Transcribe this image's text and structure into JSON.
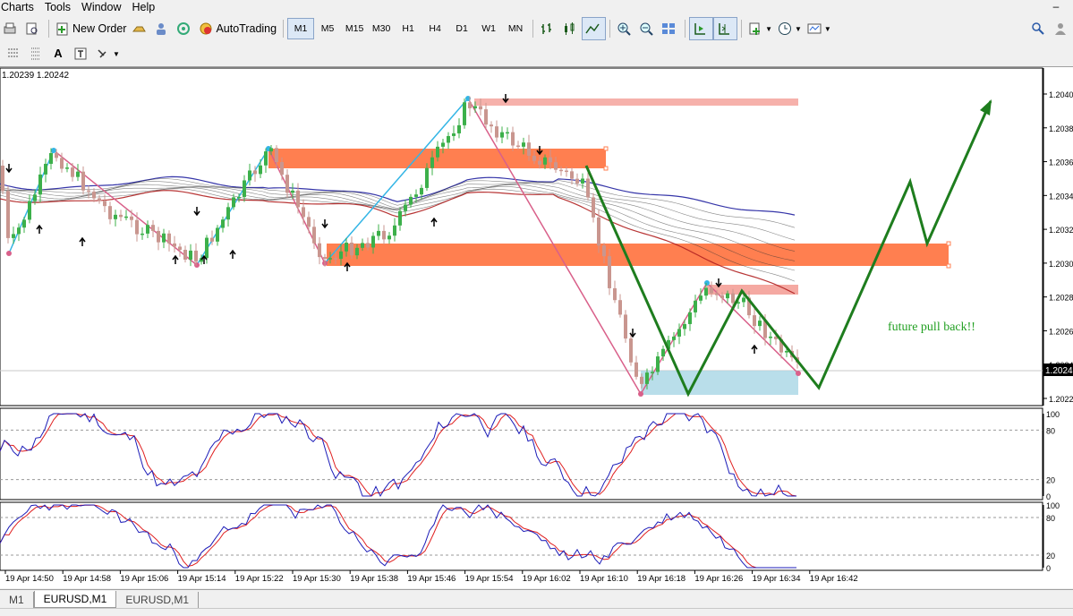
{
  "menu": {
    "items": [
      "Charts",
      "Tools",
      "Window",
      "Help"
    ]
  },
  "toolbar": {
    "new_order": "New Order",
    "autotrading": "AutoTrading",
    "timeframes": [
      "M1",
      "M5",
      "M15",
      "M30",
      "H1",
      "H4",
      "D1",
      "W1",
      "MN"
    ],
    "active_timeframe": "M1"
  },
  "chart": {
    "ohlc_label": "1.20239 1.20242",
    "current_price": "1.2024",
    "price_labels": [
      "1.2040",
      "1.2038",
      "1.2036",
      "1.2034",
      "1.2032",
      "1.2030",
      "1.2028",
      "1.2026",
      "1.2024",
      "1.2022"
    ],
    "time_labels": [
      "19 Apr 14:50",
      "19 Apr 14:58",
      "19 Apr 15:06",
      "19 Apr 15:14",
      "19 Apr 15:22",
      "19 Apr 15:30",
      "19 Apr 15:38",
      "19 Apr 15:46",
      "19 Apr 15:54",
      "19 Apr 16:02",
      "19 Apr 16:10",
      "19 Apr 16:18",
      "19 Apr 16:26",
      "19 Apr 16:34",
      "19 Apr 16:42"
    ],
    "annotation": "future pull back!!",
    "osc1_levels": [
      "100",
      "80",
      "20",
      "0"
    ],
    "osc2_levels": [
      "100",
      "80",
      "20",
      "0"
    ],
    "colors": {
      "bull": "#3cb04a",
      "bear": "#c9968f",
      "zone": "#ff7f50",
      "zone_light": "#f5a9a2",
      "demand": "#add8e6",
      "projection": "#1e7d1e",
      "zigzag_blue": "#33b5e5",
      "zigzag_pink": "#d9608a",
      "stoch_main": "#1c1cb8",
      "stoch_signal": "#e02020"
    }
  },
  "tabs": [
    "M1",
    "EURUSD,M1",
    "EURUSD,M1"
  ],
  "active_tab": "EURUSD,M1"
}
